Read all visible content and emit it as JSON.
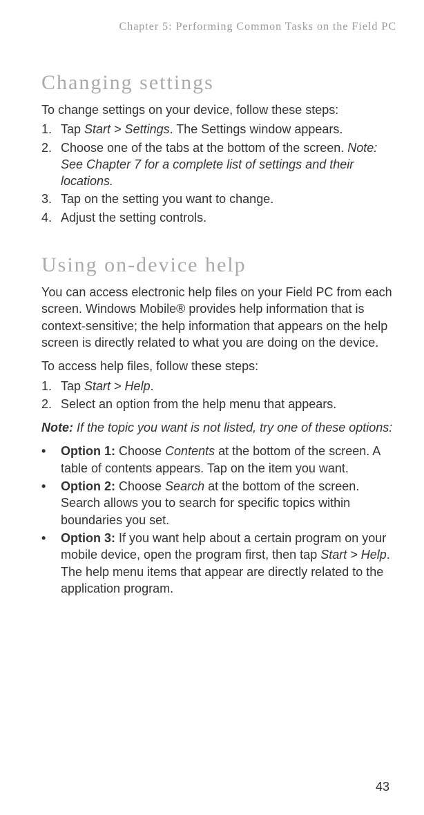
{
  "header": {
    "chapter": "Chapter 5:  Performing Common Tasks on the Field PC"
  },
  "section1": {
    "heading": "Changing settings",
    "intro": "To change settings on your device, follow these steps:",
    "steps": {
      "s1_pre": "Tap ",
      "s1_italic": "Start > Settings",
      "s1_post": ". The Settings window appears.",
      "s2_pre": "Choose one of the tabs at the bottom of the screen. ",
      "s2_italic": "Note: See Chapter 7 for a complete list of settings and their locations.",
      "s3": "Tap on the setting you want to change.",
      "s4": "Adjust the setting controls."
    }
  },
  "section2": {
    "heading": "Using on-device help",
    "para1": "You can access electronic help files on your Field PC from each screen. Windows Mobile® provides help information that is context-sensitive; the help information that appears on the help screen is directly related to what you are doing on the device.",
    "intro2": "To access help files, follow these steps:",
    "steps": {
      "s1_pre": "Tap ",
      "s1_italic": "Start > Help",
      "s1_post": ".",
      "s2": "Select an option from the help menu that appears."
    },
    "note_label": "Note:",
    "note_body": " If the topic you want is not listed, try one of these options:",
    "options": {
      "o1_label": "Option 1:",
      "o1_pre": " Choose ",
      "o1_italic": "Contents",
      "o1_post": " at the bottom of the screen. A table of contents appears. Tap on the item you want.",
      "o2_label": "Option 2:",
      "o2_pre": " Choose ",
      "o2_italic": "Search",
      "o2_post": " at the bottom of the screen. Search allows you to search for specific topics within boundaries you set.",
      "o3_label": "Option 3:",
      "o3_pre": " If you want help about a certain program on your mobile device, open the program first, then tap ",
      "o3_italic": "Start > Help",
      "o3_post": ". The help menu items that appear are directly related to the application program."
    }
  },
  "page_number": "43"
}
